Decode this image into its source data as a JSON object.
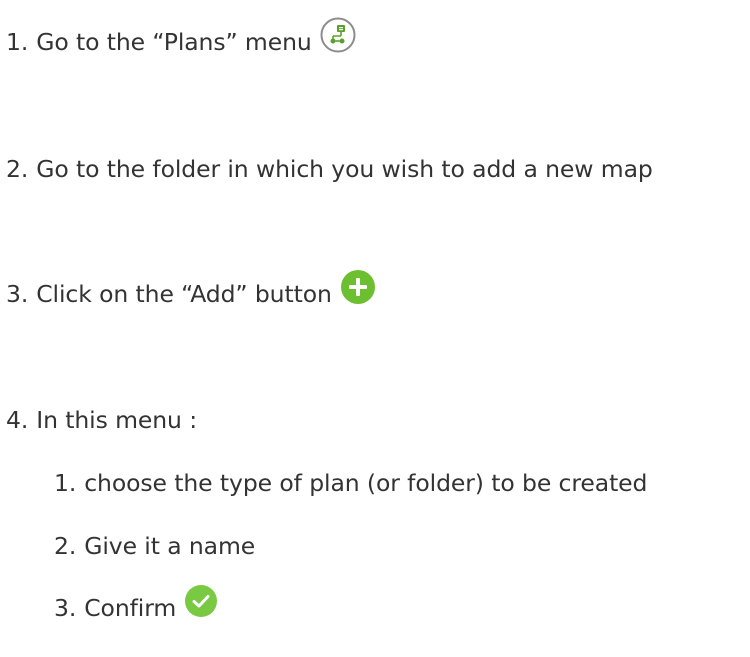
{
  "steps": [
    {
      "num": "1.",
      "text": "Go to the “Plans” menu",
      "icon": "plans-menu-icon"
    },
    {
      "num": "2.",
      "text": "Go to the folder in which you wish to add a new map"
    },
    {
      "num": "3.",
      "text": "Click on the “Add” button",
      "icon": "add-icon"
    },
    {
      "num": "4.",
      "text": "In this menu :"
    }
  ],
  "substeps": [
    {
      "num": "1.",
      "text": "choose the type of plan (or folder) to be created"
    },
    {
      "num": "2.",
      "text": "Give it a name"
    },
    {
      "num": "3.",
      "text": "Confirm",
      "icon": "confirm-check-icon"
    }
  ],
  "colors": {
    "text": "#333333",
    "add_green": "#6cbf2f",
    "confirm_green": "#7ac943",
    "plans_icon_green": "#5aa02c",
    "plans_icon_border": "#8c8c8c"
  }
}
